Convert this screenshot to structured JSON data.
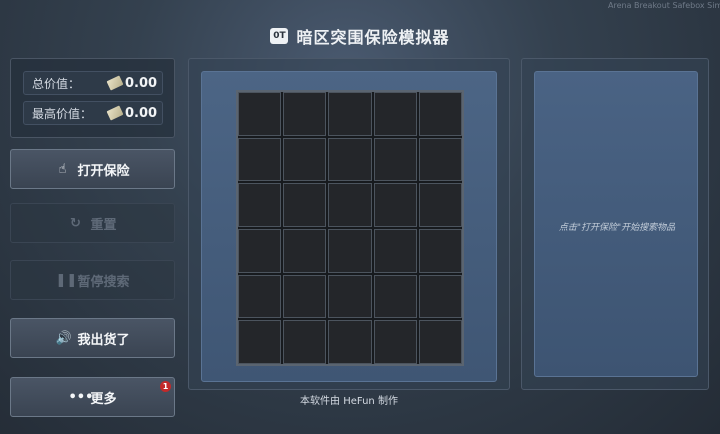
{
  "watermark": "Arena Breakout Safebox Sim",
  "app": {
    "title": "暗区突围保险模拟器",
    "logo_text": "0T"
  },
  "stats": {
    "total_label": "总价值：",
    "total_value": "0.00",
    "max_label": "最高价值：",
    "max_value": "0.00"
  },
  "buttons": {
    "open": {
      "icon": "hand-pointer-icon",
      "label": "打开保险",
      "enabled": true
    },
    "reset": {
      "icon": "refresh-icon",
      "label": "重置",
      "enabled": false
    },
    "pause": {
      "icon": "pause-icon",
      "label": "暂停搜索",
      "enabled": false
    },
    "sold": {
      "icon": "speaker-icon",
      "label": "我出货了",
      "enabled": true
    },
    "more": {
      "icon": "ellipsis-icon",
      "label": "更多",
      "enabled": true,
      "badge": "1"
    }
  },
  "grid": {
    "columns": 5,
    "rows": 6
  },
  "credit": "本软件由 HeFun 制作",
  "hint": "点击\"打开保险\"开始搜索物品",
  "colors": {
    "badge": "#c22a2a",
    "grid_bg": "#24262a",
    "panel_accent": "#4a6384"
  }
}
